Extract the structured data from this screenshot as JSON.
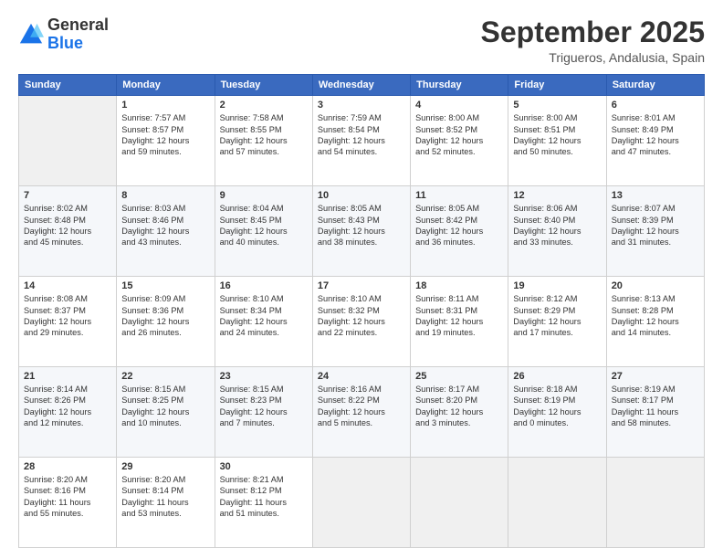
{
  "logo": {
    "line1": "General",
    "line2": "Blue"
  },
  "title": "September 2025",
  "location": "Trigueros, Andalusia, Spain",
  "weekdays": [
    "Sunday",
    "Monday",
    "Tuesday",
    "Wednesday",
    "Thursday",
    "Friday",
    "Saturday"
  ],
  "weeks": [
    [
      {
        "day": "",
        "info": ""
      },
      {
        "day": "1",
        "info": "Sunrise: 7:57 AM\nSunset: 8:57 PM\nDaylight: 12 hours\nand 59 minutes."
      },
      {
        "day": "2",
        "info": "Sunrise: 7:58 AM\nSunset: 8:55 PM\nDaylight: 12 hours\nand 57 minutes."
      },
      {
        "day": "3",
        "info": "Sunrise: 7:59 AM\nSunset: 8:54 PM\nDaylight: 12 hours\nand 54 minutes."
      },
      {
        "day": "4",
        "info": "Sunrise: 8:00 AM\nSunset: 8:52 PM\nDaylight: 12 hours\nand 52 minutes."
      },
      {
        "day": "5",
        "info": "Sunrise: 8:00 AM\nSunset: 8:51 PM\nDaylight: 12 hours\nand 50 minutes."
      },
      {
        "day": "6",
        "info": "Sunrise: 8:01 AM\nSunset: 8:49 PM\nDaylight: 12 hours\nand 47 minutes."
      }
    ],
    [
      {
        "day": "7",
        "info": "Sunrise: 8:02 AM\nSunset: 8:48 PM\nDaylight: 12 hours\nand 45 minutes."
      },
      {
        "day": "8",
        "info": "Sunrise: 8:03 AM\nSunset: 8:46 PM\nDaylight: 12 hours\nand 43 minutes."
      },
      {
        "day": "9",
        "info": "Sunrise: 8:04 AM\nSunset: 8:45 PM\nDaylight: 12 hours\nand 40 minutes."
      },
      {
        "day": "10",
        "info": "Sunrise: 8:05 AM\nSunset: 8:43 PM\nDaylight: 12 hours\nand 38 minutes."
      },
      {
        "day": "11",
        "info": "Sunrise: 8:05 AM\nSunset: 8:42 PM\nDaylight: 12 hours\nand 36 minutes."
      },
      {
        "day": "12",
        "info": "Sunrise: 8:06 AM\nSunset: 8:40 PM\nDaylight: 12 hours\nand 33 minutes."
      },
      {
        "day": "13",
        "info": "Sunrise: 8:07 AM\nSunset: 8:39 PM\nDaylight: 12 hours\nand 31 minutes."
      }
    ],
    [
      {
        "day": "14",
        "info": "Sunrise: 8:08 AM\nSunset: 8:37 PM\nDaylight: 12 hours\nand 29 minutes."
      },
      {
        "day": "15",
        "info": "Sunrise: 8:09 AM\nSunset: 8:36 PM\nDaylight: 12 hours\nand 26 minutes."
      },
      {
        "day": "16",
        "info": "Sunrise: 8:10 AM\nSunset: 8:34 PM\nDaylight: 12 hours\nand 24 minutes."
      },
      {
        "day": "17",
        "info": "Sunrise: 8:10 AM\nSunset: 8:32 PM\nDaylight: 12 hours\nand 22 minutes."
      },
      {
        "day": "18",
        "info": "Sunrise: 8:11 AM\nSunset: 8:31 PM\nDaylight: 12 hours\nand 19 minutes."
      },
      {
        "day": "19",
        "info": "Sunrise: 8:12 AM\nSunset: 8:29 PM\nDaylight: 12 hours\nand 17 minutes."
      },
      {
        "day": "20",
        "info": "Sunrise: 8:13 AM\nSunset: 8:28 PM\nDaylight: 12 hours\nand 14 minutes."
      }
    ],
    [
      {
        "day": "21",
        "info": "Sunrise: 8:14 AM\nSunset: 8:26 PM\nDaylight: 12 hours\nand 12 minutes."
      },
      {
        "day": "22",
        "info": "Sunrise: 8:15 AM\nSunset: 8:25 PM\nDaylight: 12 hours\nand 10 minutes."
      },
      {
        "day": "23",
        "info": "Sunrise: 8:15 AM\nSunset: 8:23 PM\nDaylight: 12 hours\nand 7 minutes."
      },
      {
        "day": "24",
        "info": "Sunrise: 8:16 AM\nSunset: 8:22 PM\nDaylight: 12 hours\nand 5 minutes."
      },
      {
        "day": "25",
        "info": "Sunrise: 8:17 AM\nSunset: 8:20 PM\nDaylight: 12 hours\nand 3 minutes."
      },
      {
        "day": "26",
        "info": "Sunrise: 8:18 AM\nSunset: 8:19 PM\nDaylight: 12 hours\nand 0 minutes."
      },
      {
        "day": "27",
        "info": "Sunrise: 8:19 AM\nSunset: 8:17 PM\nDaylight: 11 hours\nand 58 minutes."
      }
    ],
    [
      {
        "day": "28",
        "info": "Sunrise: 8:20 AM\nSunset: 8:16 PM\nDaylight: 11 hours\nand 55 minutes."
      },
      {
        "day": "29",
        "info": "Sunrise: 8:20 AM\nSunset: 8:14 PM\nDaylight: 11 hours\nand 53 minutes."
      },
      {
        "day": "30",
        "info": "Sunrise: 8:21 AM\nSunset: 8:12 PM\nDaylight: 11 hours\nand 51 minutes."
      },
      {
        "day": "",
        "info": ""
      },
      {
        "day": "",
        "info": ""
      },
      {
        "day": "",
        "info": ""
      },
      {
        "day": "",
        "info": ""
      }
    ]
  ]
}
